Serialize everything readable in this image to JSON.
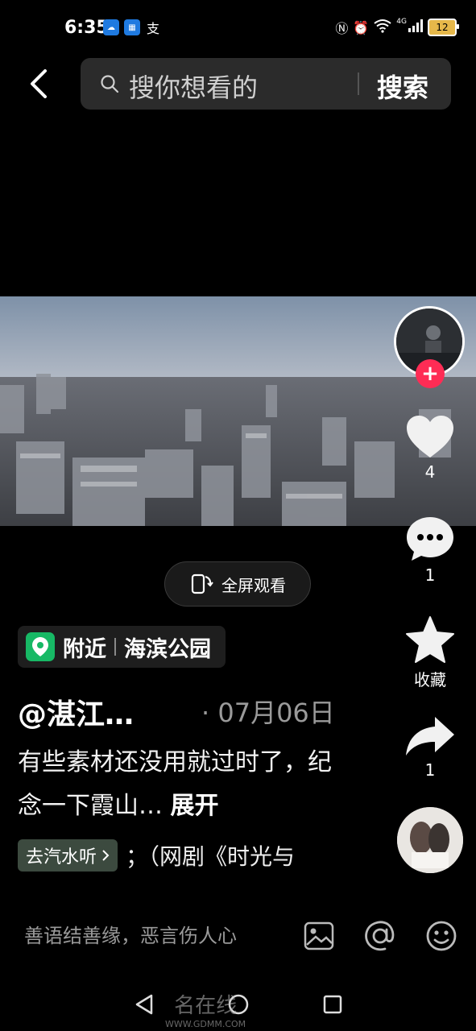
{
  "status_bar": {
    "time": "6:35",
    "notification_icons": [
      "cloud-icon",
      "app-icon",
      "alipay-icon"
    ],
    "alipay_glyph": "支",
    "network": "4G",
    "battery": "12"
  },
  "top_bar": {
    "search_placeholder": "搜你想看的",
    "search_button": "搜索"
  },
  "video": {
    "fullscreen_label": "全屏观看"
  },
  "right_rail": {
    "follow_symbol": "+",
    "like_count": "4",
    "comment_count": "1",
    "favorite_label": "收藏",
    "share_count": "1"
  },
  "info": {
    "location_nearby": "附近",
    "location_place": "海滨公园",
    "author": "@湛江…",
    "date": "· 07月06日",
    "description": "有些素材还没用就过时了，纪念一下霞山…",
    "expand": "展开",
    "music_chip": "去汽水听",
    "music_name": "；（网剧《时光与"
  },
  "comment_bar": {
    "placeholder": "善语结善缘，恶言伤人心"
  },
  "watermark": {
    "text": "名在线",
    "url": "WWW.GDMM.COM"
  },
  "colors": {
    "follow_red": "#fe2c55",
    "location_green": "#17b965",
    "search_bg": "#2b2b2b"
  }
}
